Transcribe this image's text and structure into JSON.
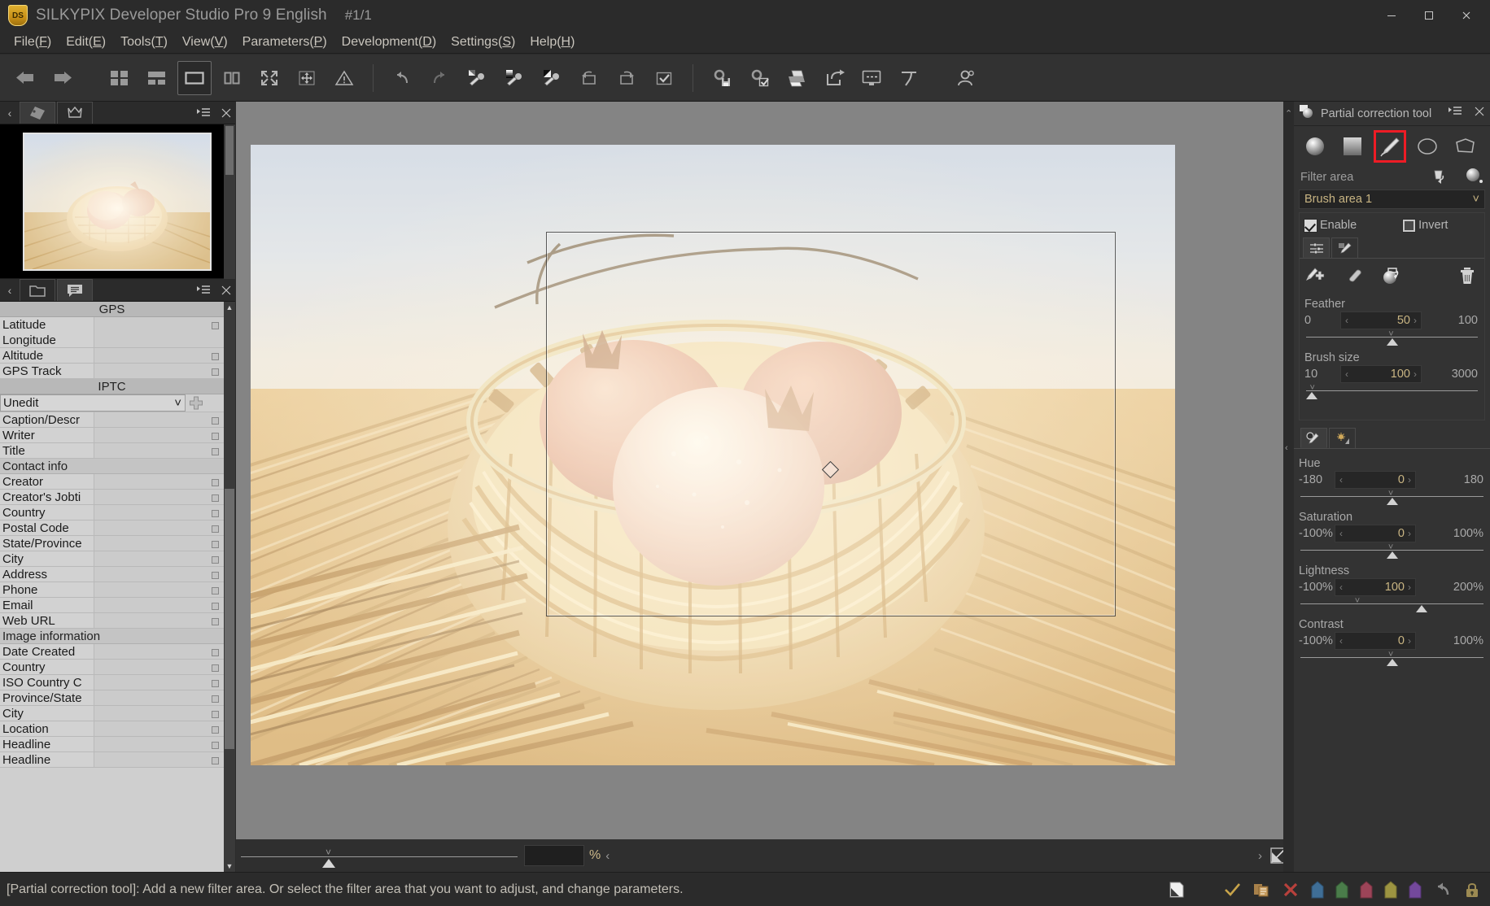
{
  "window": {
    "app_name": "SILKYPIX Developer Studio Pro 9 English",
    "logo_text": "DS",
    "counter": "#1/1",
    "minimize_label": "Minimize",
    "maximize_label": "Maximize",
    "close_label": "Close"
  },
  "menubar": {
    "items": [
      {
        "label": "File",
        "accel": "F"
      },
      {
        "label": "Edit",
        "accel": "E"
      },
      {
        "label": "Tools",
        "accel": "T"
      },
      {
        "label": "View",
        "accel": "V"
      },
      {
        "label": "Parameters",
        "accel": "P"
      },
      {
        "label": "Development",
        "accel": "D"
      },
      {
        "label": "Settings",
        "accel": "S"
      },
      {
        "label": "Help",
        "accel": "H"
      }
    ]
  },
  "toolbar": {
    "items": [
      {
        "name": "previous-image-button",
        "icon": "arrow-left-icon",
        "selected": false
      },
      {
        "name": "next-image-button",
        "icon": "arrow-right-icon",
        "selected": false
      },
      {
        "name": "thumbnail-grid-view-button",
        "icon": "grid-view-icon",
        "selected": false
      },
      {
        "name": "combination-view-button",
        "icon": "combination-view-icon",
        "selected": false
      },
      {
        "name": "single-image-view-button",
        "icon": "single-view-icon",
        "selected": true
      },
      {
        "name": "two-image-view-button",
        "icon": "dual-view-icon",
        "selected": false
      },
      {
        "name": "fullscreen-button",
        "icon": "expand-arrows-icon",
        "selected": false
      },
      {
        "name": "fit-to-window-button",
        "icon": "fit-window-icon",
        "selected": false
      },
      {
        "name": "warning-button",
        "icon": "warning-triangle-icon",
        "selected": false
      },
      {
        "name": "undo-button",
        "icon": "undo-icon",
        "selected": false
      },
      {
        "name": "redo-button",
        "icon": "redo-icon",
        "selected": false
      },
      {
        "name": "white-balance-dropper-button",
        "icon": "wb-dropper-icon",
        "selected": false
      },
      {
        "name": "gray-balance-dropper-button",
        "icon": "gray-dropper-icon",
        "selected": false
      },
      {
        "name": "black-point-dropper-button",
        "icon": "black-dropper-icon",
        "selected": false
      },
      {
        "name": "rotate-left-button",
        "icon": "rotate-left-icon",
        "selected": false
      },
      {
        "name": "rotate-right-button",
        "icon": "rotate-right-icon",
        "selected": false
      },
      {
        "name": "mark-button",
        "icon": "checkbox-icon",
        "selected": false
      },
      {
        "name": "development-settings-save-button",
        "icon": "gear-save-icon",
        "selected": false
      },
      {
        "name": "batch-development-button",
        "icon": "gear-check-icon",
        "selected": false
      },
      {
        "name": "print-button",
        "icon": "printer-icon",
        "selected": false
      },
      {
        "name": "export-button",
        "icon": "export-arrow-icon",
        "selected": false
      },
      {
        "name": "display-settings-button",
        "icon": "monitor-icon",
        "selected": false
      },
      {
        "name": "perspective-button",
        "icon": "perspective-icon",
        "selected": false
      },
      {
        "name": "face-detect-button",
        "icon": "face-icon",
        "selected": false
      }
    ]
  },
  "left_panel": {
    "thumbnail_header": {
      "back_label": "‹",
      "tabs": [
        {
          "name": "thumbnail-tab",
          "icon": "photo-icon",
          "active": true
        },
        {
          "name": "crown-tab",
          "icon": "crown-icon",
          "active": false
        }
      ],
      "menu_icon": "panel-menu-icon",
      "close_icon": "close-icon"
    },
    "meta_header": {
      "back_label": "‹",
      "tabs": [
        {
          "name": "folder-tab",
          "icon": "folder-icon",
          "active": false
        },
        {
          "name": "metadata-tab",
          "icon": "list-bubble-icon",
          "active": true
        }
      ],
      "menu_icon": "panel-menu-icon",
      "close_icon": "close-icon"
    },
    "metadata": {
      "sections": [
        {
          "type": "section",
          "label": "GPS"
        },
        {
          "type": "row2",
          "label": "Latitude",
          "label2": "Longitude",
          "value": ""
        },
        {
          "type": "row",
          "label": "Altitude",
          "value": ""
        },
        {
          "type": "row",
          "label": "GPS Track",
          "value": ""
        },
        {
          "type": "section",
          "label": "IPTC"
        },
        {
          "type": "combo",
          "label": "Unedit",
          "value": "Unedit"
        },
        {
          "type": "row",
          "label": "Caption/Descr",
          "value": ""
        },
        {
          "type": "row",
          "label": "Writer",
          "value": ""
        },
        {
          "type": "row",
          "label": "Title",
          "value": ""
        },
        {
          "type": "sub",
          "label": "Contact info"
        },
        {
          "type": "row",
          "label": "Creator",
          "value": ""
        },
        {
          "type": "row",
          "label": "Creator's Jobti",
          "value": ""
        },
        {
          "type": "row",
          "label": "Country",
          "value": ""
        },
        {
          "type": "row",
          "label": "Postal Code",
          "value": ""
        },
        {
          "type": "row",
          "label": "State/Province",
          "value": ""
        },
        {
          "type": "row",
          "label": "City",
          "value": ""
        },
        {
          "type": "row",
          "label": "Address",
          "value": ""
        },
        {
          "type": "row",
          "label": "Phone",
          "value": ""
        },
        {
          "type": "row",
          "label": "Email",
          "value": ""
        },
        {
          "type": "row",
          "label": "Web URL",
          "value": ""
        },
        {
          "type": "sub",
          "label": "Image information"
        },
        {
          "type": "row",
          "label": "Date Created",
          "value": ""
        },
        {
          "type": "row",
          "label": "Country",
          "value": ""
        },
        {
          "type": "row",
          "label": "ISO Country C",
          "value": ""
        },
        {
          "type": "row",
          "label": "Province/State",
          "value": ""
        },
        {
          "type": "row",
          "label": "City",
          "value": ""
        },
        {
          "type": "row",
          "label": "Location",
          "value": ""
        },
        {
          "type": "row",
          "label": "Headline",
          "value": ""
        },
        {
          "type": "row",
          "label": "Headline",
          "value": ""
        }
      ]
    }
  },
  "canvas": {
    "zoom_value": "",
    "zoom_unit": "%",
    "prev_arrow": "‹",
    "next_arrow": "›",
    "fit_icon": "fit-image-icon"
  },
  "right_panel": {
    "title": "Partial correction tool",
    "title_icon": "partial-correction-icon",
    "menu_icon": "panel-menu-icon",
    "close_icon": "close-icon",
    "tools": [
      {
        "name": "circular-gradient-tool",
        "icon": "radial-gradient-icon",
        "selected": false
      },
      {
        "name": "linear-gradient-tool",
        "icon": "linear-gradient-icon",
        "selected": false
      },
      {
        "name": "brush-tool",
        "icon": "brush-icon",
        "selected": true
      },
      {
        "name": "ellipse-tool",
        "icon": "ellipse-icon",
        "selected": false
      },
      {
        "name": "polygon-tool",
        "icon": "polygon-icon",
        "selected": false
      }
    ],
    "filter_area_label": "Filter area",
    "filter_area_icons": [
      {
        "name": "reset-filter-icon",
        "icon": "bucket-undo-icon"
      },
      {
        "name": "show-mask-icon",
        "icon": "sphere-dot-icon"
      }
    ],
    "selected_area": "Brush area 1",
    "enable_label": "Enable",
    "enable_checked": true,
    "invert_label": "Invert",
    "invert_checked": false,
    "area_tabs": [
      {
        "name": "area-settings-tab",
        "icon": "sliders-icon",
        "active": true
      },
      {
        "name": "area-effects-tab",
        "icon": "mask-brush-icon",
        "active": false
      }
    ],
    "brush_buttons": [
      {
        "name": "brush-add-button",
        "icon": "brush-plus-icon"
      },
      {
        "name": "eraser-button",
        "icon": "eraser-icon"
      },
      {
        "name": "auto-mask-button",
        "icon": "auto-mask-icon"
      },
      {
        "name": "delete-area-button",
        "icon": "trash-icon"
      }
    ],
    "brush_sliders": [
      {
        "name": "feather",
        "label": "Feather",
        "min": "0",
        "max": "100",
        "value": "50",
        "pos_pct": 50
      },
      {
        "name": "brush-size",
        "label": "Brush size",
        "min": "10",
        "max": "3000",
        "value": "100",
        "pos_pct": 3
      }
    ],
    "param_tabs": [
      {
        "name": "color-params-tab",
        "icon": "color-brush-icon",
        "active": true
      },
      {
        "name": "exposure-params-tab",
        "icon": "exposure-icon",
        "active": false
      }
    ],
    "param_sliders": [
      {
        "name": "hue",
        "label": "Hue",
        "min": "-180",
        "max": "180",
        "value": "0",
        "pos_pct": 50
      },
      {
        "name": "saturation",
        "label": "Saturation",
        "min": "-100%",
        "max": "100%",
        "value": "0",
        "pos_pct": 50
      },
      {
        "name": "lightness",
        "label": "Lightness",
        "min": "-100%",
        "max": "200%",
        "value": "100",
        "pos_pct": 67
      },
      {
        "name": "contrast",
        "label": "Contrast",
        "min": "-100%",
        "max": "100%",
        "value": "0",
        "pos_pct": 50
      }
    ]
  },
  "statusbar": {
    "message": "[Partial correction tool]: Add a new filter area. Or select the filter area that you want to adjust, and change parameters.",
    "left_icon": "page-corner-icon",
    "actions": [
      {
        "name": "mark-check-button",
        "icon": "check-icon",
        "color": "#c8a44a"
      },
      {
        "name": "copy-button",
        "icon": "copy-icon",
        "color": "#a8814a"
      },
      {
        "name": "delete-button",
        "icon": "x-icon",
        "color": "#b8413c"
      },
      {
        "name": "tag-blue-button",
        "icon": "tag-icon",
        "color": "#3f6e96"
      },
      {
        "name": "tag-green-button",
        "icon": "tag-icon",
        "color": "#4a7c4a"
      },
      {
        "name": "tag-red-button",
        "icon": "tag-icon",
        "color": "#9c4458"
      },
      {
        "name": "tag-yellow-button",
        "icon": "tag-icon",
        "color": "#9c9441"
      },
      {
        "name": "tag-purple-button",
        "icon": "tag-icon",
        "color": "#74499c"
      },
      {
        "name": "revert-button",
        "icon": "undo-icon",
        "color": "#8a8a8a"
      },
      {
        "name": "lock-button",
        "icon": "lock-icon",
        "color": "#9c8a52"
      }
    ]
  },
  "colors": {
    "accent_value": "#c9b583",
    "highlight_red": "#ee1c25",
    "panel_bg": "#333333",
    "window_bg": "#2b2b2b",
    "canvas_bg": "#848484"
  }
}
